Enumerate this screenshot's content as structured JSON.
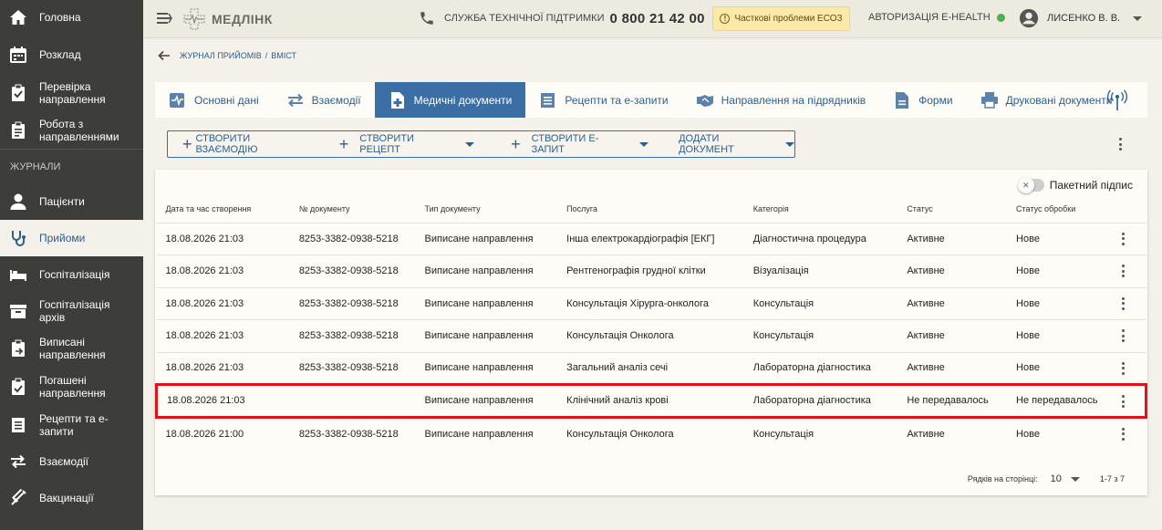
{
  "sidebar": {
    "items": [
      {
        "label": "Головна",
        "icon": "home-icon"
      },
      {
        "label": "Розклад",
        "icon": "calendar-icon"
      },
      {
        "label": "Перевірка направлення",
        "icon": "clipboard-check-icon"
      },
      {
        "label": "Робота з направленнями",
        "icon": "clipboard-list-icon"
      }
    ],
    "section": "ЖУРНАЛИ",
    "journal_items": [
      {
        "label": "Пацієнти",
        "icon": "person-icon"
      },
      {
        "label": "Прийоми",
        "icon": "stethoscope-icon",
        "active": true
      },
      {
        "label": "Госпіталізація",
        "icon": "bed-icon"
      },
      {
        "label": "Госпіталізація архів",
        "icon": "archive-icon"
      },
      {
        "label": "Виписані направлення",
        "icon": "clipboard-out-icon"
      },
      {
        "label": "Погашені направлення",
        "icon": "clipboard-done-icon"
      },
      {
        "label": "Рецепти та е-запити",
        "icon": "list-doc-icon"
      },
      {
        "label": "Взаємодії",
        "icon": "swap-icon"
      },
      {
        "label": "Вакцинації",
        "icon": "syringe-icon"
      }
    ]
  },
  "header": {
    "logo": "МЕДЛІНК",
    "support_label": "СЛУЖБА ТЕХНІЧНОЇ ПІДТРИМКИ",
    "support_phone": "0 800 21 42 00",
    "eco_status": "Часткові проблеми ЕСОЗ",
    "auth_label": "АВТОРИЗАЦІЯ E-HEALTH",
    "user_name": "ЛИСЕНКО В. В.",
    "status_color": "#4caf50"
  },
  "breadcrumb": {
    "journal": "ЖУРНАЛ ПРИЙОМІВ",
    "separator": "/",
    "current": "ВМІСТ"
  },
  "tabs": [
    {
      "label": "Основні дані",
      "icon": "pulse-icon"
    },
    {
      "label": "Взаємодії",
      "icon": "swap-icon"
    },
    {
      "label": "Медичні документи",
      "icon": "medical-doc-icon",
      "active": true
    },
    {
      "label": "Рецепти та е-запити",
      "icon": "list-doc-icon"
    },
    {
      "label": "Направлення на підрядників",
      "icon": "handshake-icon"
    },
    {
      "label": "Форми",
      "icon": "form-icon"
    },
    {
      "label": "Друковані документи",
      "icon": "printer-icon"
    }
  ],
  "actions": {
    "create_interaction": "СТВОРИТИ ВЗАЄМОДІЮ",
    "create_recipe": "СТВОРИТИ РЕЦЕПТ",
    "create_erequest": "СТВОРИТИ Е-ЗАПИТ",
    "add_document": "ДОДАТИ ДОКУМЕНТ"
  },
  "table": {
    "batch_sign_label": "Пакетний підпис",
    "columns": [
      "Дата та час створення",
      "№ документу",
      "Тип документу",
      "Послуга",
      "Категорія",
      "Статус",
      "Статус обробки"
    ],
    "rows": [
      {
        "date": "18.08.2026 21:03",
        "number": "8253-3382-0938-5218",
        "type": "Виписане направлення",
        "service": "Інша електрокардіографія [ЕКГ]",
        "category": "Діагностична процедура",
        "status": "Активне",
        "processing": "Нове"
      },
      {
        "date": "18.08.2026 21:03",
        "number": "8253-3382-0938-5218",
        "type": "Виписане направлення",
        "service": "Рентгенографія грудної клітки",
        "category": "Візуалізація",
        "status": "Активне",
        "processing": "Нове"
      },
      {
        "date": "18.08.2026 21:03",
        "number": "8253-3382-0938-5218",
        "type": "Виписане направлення",
        "service": "Консультація Хірурга-онколога",
        "category": "Консультація",
        "status": "Активне",
        "processing": "Нове"
      },
      {
        "date": "18.08.2026 21:03",
        "number": "8253-3382-0938-5218",
        "type": "Виписане направлення",
        "service": "Консультація Онколога",
        "category": "Консультація",
        "status": "Активне",
        "processing": "Нове"
      },
      {
        "date": "18.08.2026 21:03",
        "number": "8253-3382-0938-5218",
        "type": "Виписане направлення",
        "service": "Загальний аналіз сечі",
        "category": "Лабораторна діагностика",
        "status": "Активне",
        "processing": "Нове"
      },
      {
        "date": "18.08.2026 21:03",
        "number": "",
        "type": "Виписане направлення",
        "service": "Клінічний аналіз крові",
        "category": "Лабораторна діагностика",
        "status": "Не передавалось",
        "processing": "Не передавалось",
        "highlight": true
      },
      {
        "date": "18.08.2026 21:00",
        "number": "8253-3382-0938-5218",
        "type": "Виписане направлення",
        "service": "Консультація Онколога",
        "category": "Консультація",
        "status": "Активне",
        "processing": "Нове"
      }
    ],
    "pager": {
      "rows_label": "Рядків на сторінці:",
      "rows_value": "10",
      "range": "1-7 з 7"
    }
  },
  "colors": {
    "accent": "#3a6ea5",
    "highlight": "#e0121a",
    "sidebar": "#3d3d39",
    "warning_bg": "#fbe9a8"
  }
}
